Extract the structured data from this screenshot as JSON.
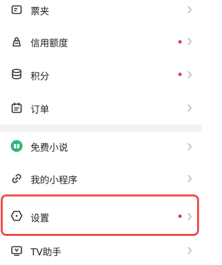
{
  "menu": {
    "items": [
      {
        "label": "票夹",
        "icon": "ticket-wallet-icon",
        "has_dot": false
      },
      {
        "label": "信用额度",
        "icon": "credit-limit-icon",
        "has_dot": true
      },
      {
        "label": "积分",
        "icon": "points-coins-icon",
        "has_dot": true
      },
      {
        "label": "订单",
        "icon": "order-calendar-icon",
        "has_dot": false
      },
      {
        "label": "免费小说",
        "icon": "free-novel-book-icon",
        "has_dot": false
      },
      {
        "label": "我的小程序",
        "icon": "mini-program-link-icon",
        "has_dot": false
      },
      {
        "label": "设置",
        "icon": "settings-hexagon-icon",
        "has_dot": true
      },
      {
        "label": "TV助手",
        "icon": "tv-assistant-icon",
        "has_dot": false
      }
    ]
  },
  "colors": {
    "dot": "#e8336b",
    "highlight_border": "#f05050",
    "novel_icon_green": "#2bb673",
    "divider_bg": "#f3f3f3",
    "chevron": "#b5b5b5"
  }
}
